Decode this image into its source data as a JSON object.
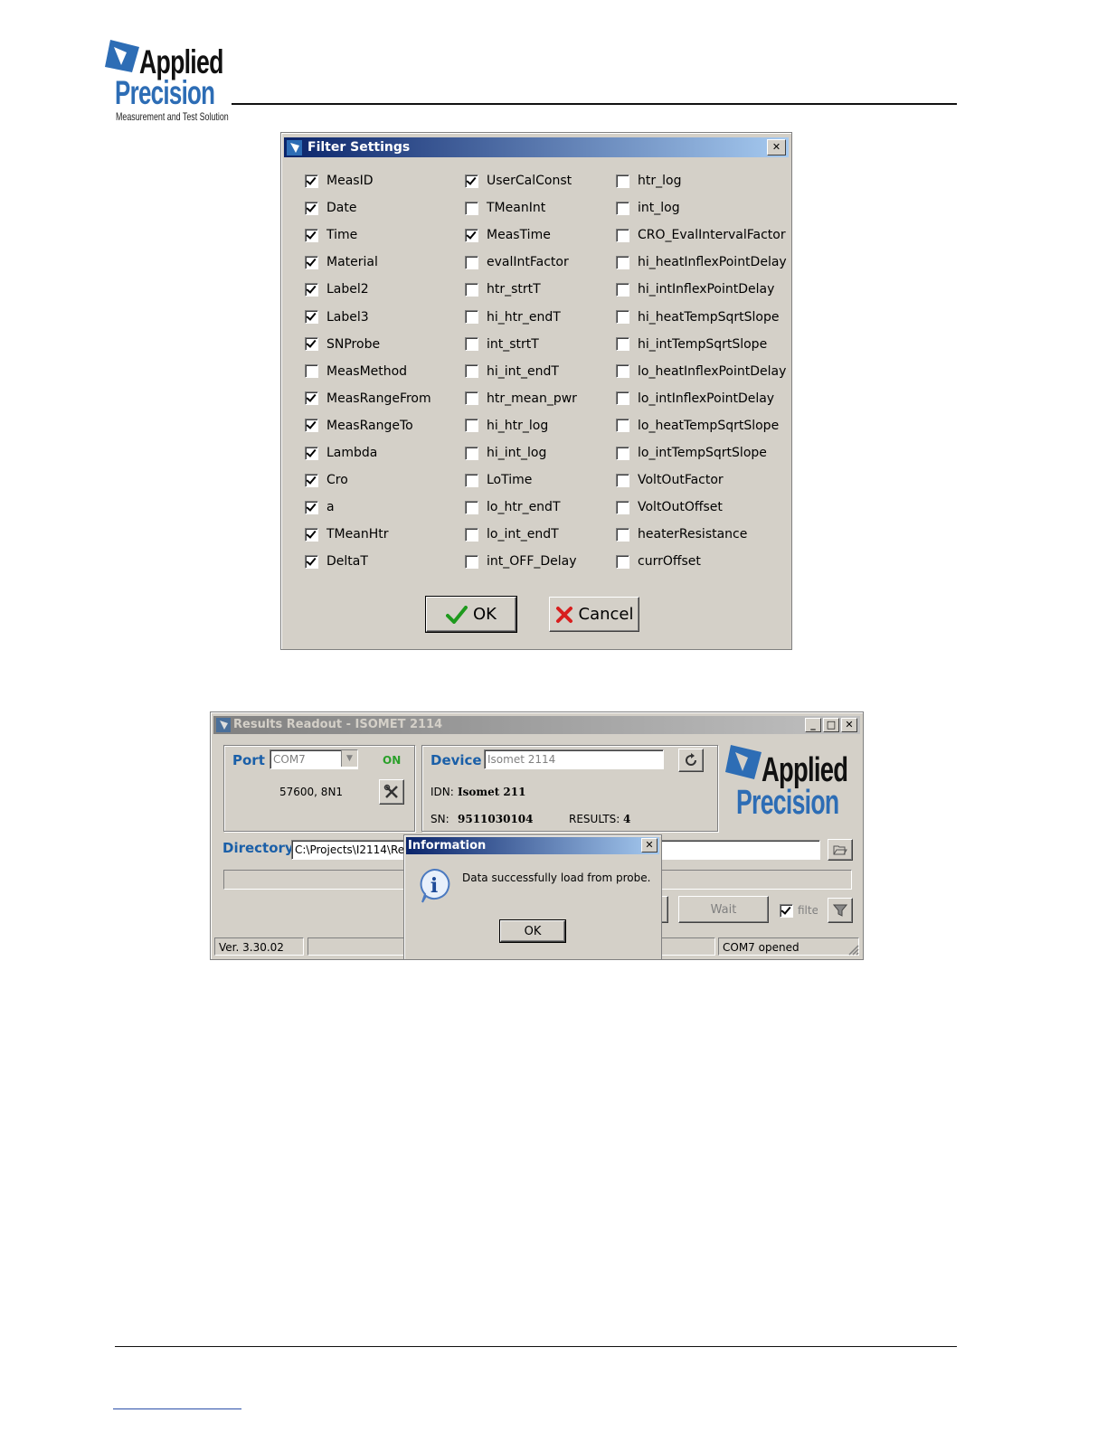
{
  "header": {
    "logo": {
      "line1": "Applied",
      "line2": "Precision",
      "tagline": "Measurement and Test Solution"
    }
  },
  "filter_dialog": {
    "title": "Filter Settings",
    "close_label": "✕",
    "columns": [
      [
        {
          "label": "MeasID",
          "checked": true
        },
        {
          "label": "Date",
          "checked": true
        },
        {
          "label": "Time",
          "checked": true
        },
        {
          "label": "Material",
          "checked": true
        },
        {
          "label": "Label2",
          "checked": true
        },
        {
          "label": "Label3",
          "checked": true
        },
        {
          "label": "SNProbe",
          "checked": true
        },
        {
          "label": "MeasMethod",
          "checked": false
        },
        {
          "label": "MeasRangeFrom",
          "checked": true
        },
        {
          "label": "MeasRangeTo",
          "checked": true
        },
        {
          "label": "Lambda",
          "checked": true
        },
        {
          "label": "Cro",
          "checked": true
        },
        {
          "label": "a",
          "checked": true
        },
        {
          "label": "TMeanHtr",
          "checked": true
        },
        {
          "label": "DeltaT",
          "checked": true
        }
      ],
      [
        {
          "label": "UserCalConst",
          "checked": true
        },
        {
          "label": "TMeanInt",
          "checked": false
        },
        {
          "label": "MeasTime",
          "checked": true
        },
        {
          "label": "evalIntFactor",
          "checked": false
        },
        {
          "label": "htr_strtT",
          "checked": false
        },
        {
          "label": "hi_htr_endT",
          "checked": false
        },
        {
          "label": "int_strtT",
          "checked": false
        },
        {
          "label": "hi_int_endT",
          "checked": false
        },
        {
          "label": "htr_mean_pwr",
          "checked": false
        },
        {
          "label": "hi_htr_log",
          "checked": false
        },
        {
          "label": "hi_int_log",
          "checked": false
        },
        {
          "label": "LoTime",
          "checked": false
        },
        {
          "label": "lo_htr_endT",
          "checked": false
        },
        {
          "label": "lo_int_endT",
          "checked": false
        },
        {
          "label": "int_OFF_Delay",
          "checked": false
        }
      ],
      [
        {
          "label": "htr_log",
          "checked": false
        },
        {
          "label": "int_log",
          "checked": false
        },
        {
          "label": "CRO_EvalIntervalFactor",
          "checked": false
        },
        {
          "label": "hi_heatInflexPointDelay",
          "checked": false
        },
        {
          "label": "hi_intInflexPointDelay",
          "checked": false
        },
        {
          "label": "hi_heatTempSqrtSlope",
          "checked": false
        },
        {
          "label": "hi_intTempSqrtSlope",
          "checked": false
        },
        {
          "label": "lo_heatInflexPointDelay",
          "checked": false
        },
        {
          "label": "lo_intInflexPointDelay",
          "checked": false
        },
        {
          "label": "lo_heatTempSqrtSlope",
          "checked": false
        },
        {
          "label": "lo_intTempSqrtSlope",
          "checked": false
        },
        {
          "label": "VoltOutFactor",
          "checked": false
        },
        {
          "label": "VoltOutOffset",
          "checked": false
        },
        {
          "label": "heaterResistance",
          "checked": false
        },
        {
          "label": "currOffset",
          "checked": false
        }
      ]
    ],
    "ok_label": "OK",
    "cancel_label": "Cancel"
  },
  "results_window": {
    "title": "Results Readout - ISOMET 2114",
    "port": {
      "label": "Port",
      "value": "COM7",
      "status": "ON",
      "settings": "57600, 8N1"
    },
    "device": {
      "label": "Device",
      "value": "Isomet 2114",
      "idn_label": "IDN:",
      "idn_value": "Isomet 211",
      "sn_label": "SN:",
      "sn_value": "9511030104",
      "results_label": "RESULTS:",
      "results_value": "4"
    },
    "logo": {
      "line1": "Applied",
      "line2": "Precision"
    },
    "directory": {
      "label": "Directory",
      "value": "C:\\Projects\\I2114\\Re"
    },
    "wait_label": "Wait",
    "filter_label": "filter",
    "status_bar": {
      "version": "Ver. 3.30.02",
      "port_status": "COM7 opened"
    }
  },
  "info_dialog": {
    "title": "Information",
    "message": "Data successfully load from probe.",
    "ok_label": "OK"
  }
}
